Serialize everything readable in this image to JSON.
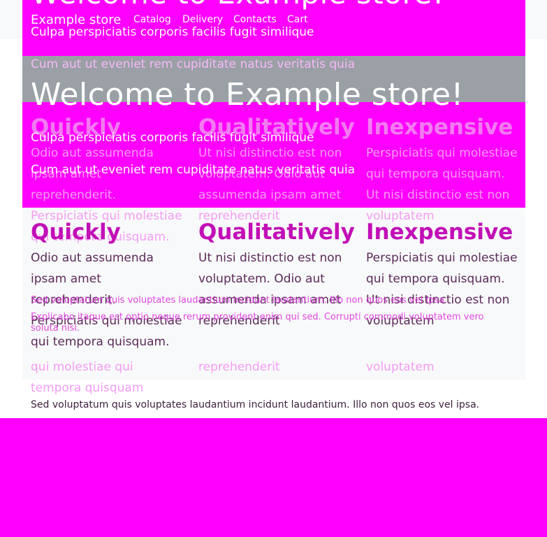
{
  "hero": {
    "title": "Welcome to Example store!"
  },
  "header": {
    "brand": "Example store",
    "nav": [
      "Catalog",
      "Delivery",
      "Contacts",
      "Cart"
    ],
    "subtitle": "Culpa perspiciatis corporis facilis fugit similique",
    "lead": "Cum aut ut eveniet rem cupiditate natus veritatis quia"
  },
  "features": [
    {
      "title": "Quickly",
      "text": "Odio aut assumenda ipsam amet reprehenderit. Perspiciatis qui molestiae qui tempora quisquam."
    },
    {
      "title": "Qualitatively",
      "text": "Ut nisi distinctio est non voluptatem. Odio aut assumenda ipsam amet reprehenderit"
    },
    {
      "title": "Inexpensive",
      "text": "Perspiciatis qui molestiae qui tempora quisquam. Ut nisi distinctio est non voluptatem"
    }
  ],
  "footer": {
    "line1": "Sed voluptatum quis voluptates laudantium incidunt laudantium. Illo non quos eos vel ipsa.",
    "line2": "Explicabo itaque est optio neque rerum provident enim qui sed. Corrupti commodi voluptatem vero soluta nisi."
  },
  "lower_text": [
    "qui molestiae qui",
    "tempora quisquam",
    "reprehenderit",
    "voluptatem"
  ],
  "colors": {
    "background": "#ff00ff",
    "accent": "#c20fb7",
    "panel": "#f8f9fa",
    "gray": "#9aa0a6"
  }
}
